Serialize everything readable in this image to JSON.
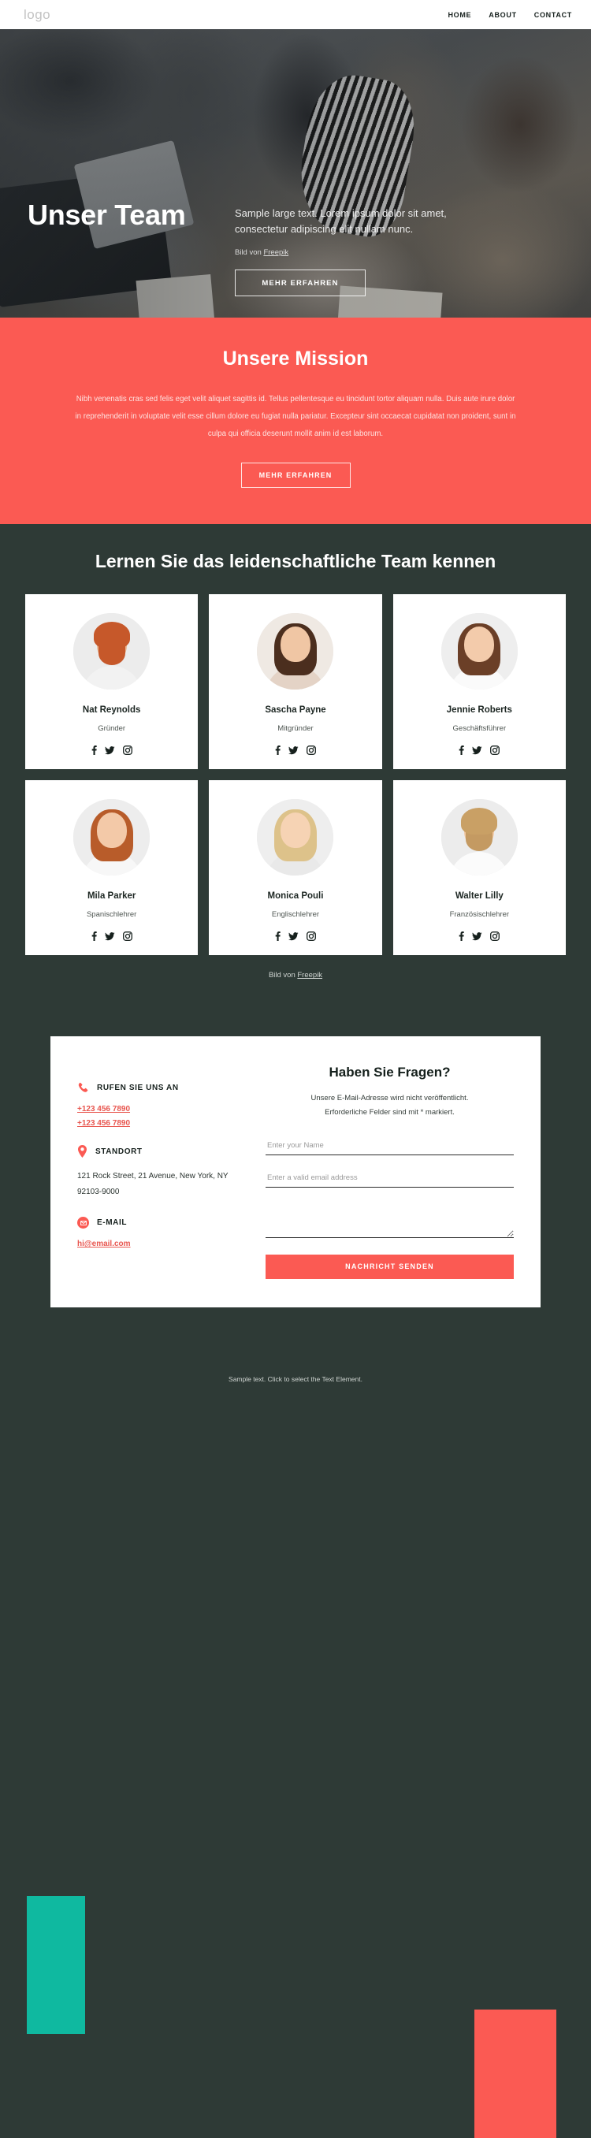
{
  "header": {
    "logo": "logo",
    "nav": [
      {
        "label": "HOME"
      },
      {
        "label": "ABOUT"
      },
      {
        "label": "CONTACT"
      }
    ]
  },
  "hero": {
    "title": "Unser Team",
    "subtitle": "Sample large text. Lorem ipsum dolor sit amet, consectetur adipiscing elit nullam nunc.",
    "credit_prefix": "Bild von ",
    "credit_link": "Freepik",
    "cta": "MEHR ERFAHREN"
  },
  "mission": {
    "heading": "Unsere Mission",
    "body": "Nibh venenatis cras sed felis eget velit aliquet sagittis id. Tellus pellentesque eu tincidunt tortor aliquam nulla. Duis aute irure dolor in reprehenderit in voluptate velit esse cillum dolore eu fugiat nulla pariatur. Excepteur sint occaecat cupidatat non proident, sunt in culpa qui officia deserunt mollit anim id est laborum.",
    "cta": "MEHR ERFAHREN",
    "background_color": "#fb5a53"
  },
  "team": {
    "heading": "Lernen Sie das leidenschaftliche Team kennen",
    "credit_prefix": "Bild von ",
    "credit_link": "Freepik",
    "socials": [
      "facebook-icon",
      "twitter-icon",
      "instagram-icon"
    ],
    "members": [
      {
        "name": "Nat Reynolds",
        "role": "Gründer"
      },
      {
        "name": "Sascha Payne",
        "role": "Mitgründer"
      },
      {
        "name": "Jennie Roberts",
        "role": "Geschäftsführer"
      },
      {
        "name": "Mila Parker",
        "role": "Spanischlehrer"
      },
      {
        "name": "Monica Pouli",
        "role": "Englischlehrer"
      },
      {
        "name": "Walter Lilly",
        "role": "Französischlehrer"
      }
    ]
  },
  "contact": {
    "phone_title": "RUFEN SIE UNS AN",
    "phone_1": "+123 456 7890",
    "phone_2": "+123 456 7890",
    "location_title": "STANDORT",
    "address_line_1": "121 Rock Street, 21 Avenue, New York, NY",
    "address_line_2": "92103-9000",
    "email_title": "E-MAIL",
    "email": "hi@email.com",
    "accent_color": "#fb5a53",
    "teal_color": "#0fb9a0"
  },
  "form": {
    "title": "Haben Sie Fragen?",
    "note_line_1": "Unsere E-Mail-Adresse wird nicht veröffentlicht.",
    "note_line_2": "Erforderliche Felder sind mit * markiert.",
    "name_placeholder": "Enter your Name",
    "name_value": "",
    "email_placeholder": "Enter a valid email address",
    "email_value": "",
    "message_placeholder": "",
    "message_value": "",
    "submit": "NACHRICHT SENDEN"
  },
  "footer": {
    "text": "Sample text. Click to select the Text Element."
  }
}
